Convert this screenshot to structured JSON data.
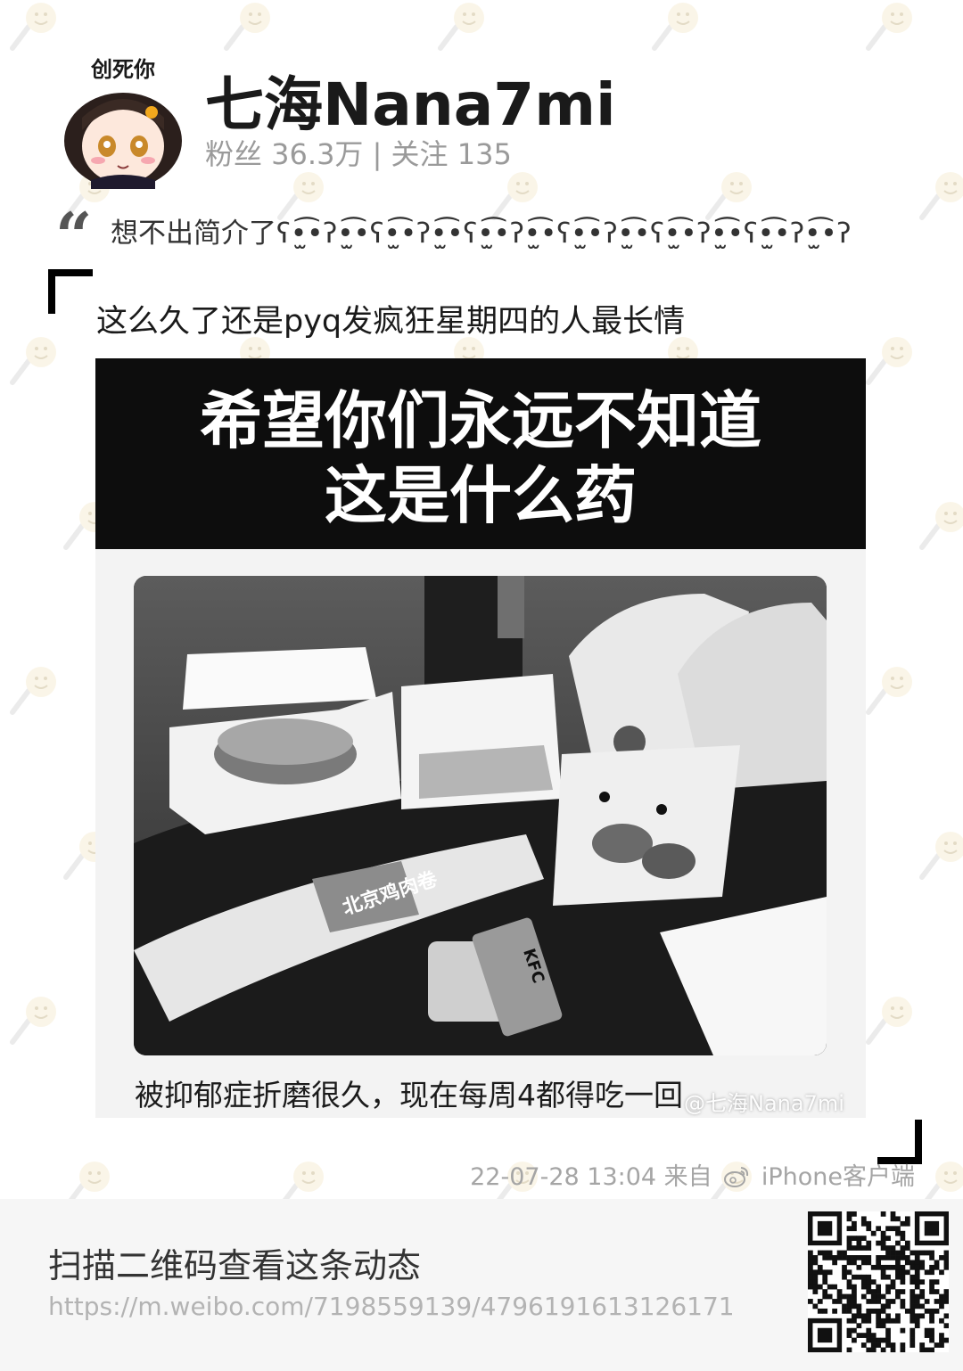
{
  "profile": {
    "avatar_caption": "创死你",
    "name": "七海Nana7mi",
    "stats": "粉丝 36.3万 | 关注 135"
  },
  "bio": {
    "quote_mark": "“",
    "text": "想不出简介了ʕ•̫͡•ʔ•̫͡•ʕ•̫͡•ʔ•̫͡•ʕ•̫͡•ʔ•̫͡•ʕ•̫͡•ʔ•̫͡•ʕ•̫͡•ʔ•̫͡•ʕ•̫͡•ʔ•̫͡•ʔ"
  },
  "post": {
    "text": "这么久了还是pyq发疯狂星期四的人最长情",
    "image": {
      "banner_line1": "希望你们永远不知道",
      "banner_line2": "这是什么药",
      "caption": "被抑郁症折磨很久，现在每周4都得吃一回",
      "watermark": "@七海Nana7mi",
      "photo_labels": {
        "wrap_label": "北京鸡肉卷",
        "packet_label": "KFC"
      }
    },
    "meta": {
      "date": "22-07-28 13:04",
      "from": "来自",
      "client": "iPhone客户端"
    }
  },
  "footer": {
    "title": "扫描二维码查看这条动态",
    "url": "https://m.weibo.com/7198559139/4796191613126171"
  },
  "colors": {
    "accent": "#000000",
    "muted": "#9a9a9a",
    "footer_bg": "#f6f6f6",
    "banner_bg": "#0d0d0d"
  },
  "icons": {
    "watermark": "smile-moon-icon",
    "quote": "quote-icon",
    "client": "weibo-icon",
    "qr": "qr-code-icon"
  }
}
